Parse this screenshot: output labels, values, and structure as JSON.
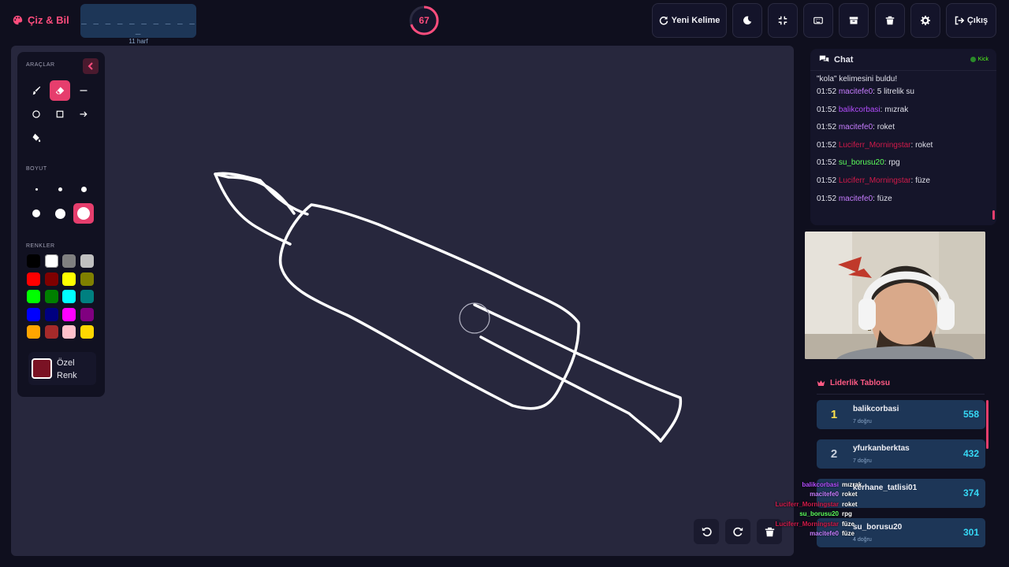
{
  "app": {
    "brand": "Çiz & Bil"
  },
  "word": {
    "dashes": "_ _ _ _ _ _ _ _ _ _ _",
    "letters": "11 harf"
  },
  "timer": {
    "value": "67",
    "fraction_remaining": 0.7
  },
  "topbar": {
    "new_word": "Yeni Kelime",
    "logout": "Çıkış"
  },
  "tools": {
    "heading": "ARAÇLAR",
    "size_heading": "BOYUT",
    "colors_heading": "RENKLER",
    "active_tool": "eraser",
    "active_size": 6,
    "custom_color_label": "Özel Renk",
    "custom_color": "#7a1224",
    "palette": [
      "#000000",
      "#ffffff",
      "#808080",
      "#c0c0c0",
      "#ff0000",
      "#800000",
      "#ffff00",
      "#808000",
      "#00ff00",
      "#008000",
      "#00ffff",
      "#008080",
      "#0000ff",
      "#000080",
      "#ff00ff",
      "#800080",
      "#ffa500",
      "#a52a2a",
      "#ffc0cb",
      "#ffd700"
    ]
  },
  "chat": {
    "title": "Chat",
    "platform": "Kick",
    "system_line1": "\"kola\" kelimesini buldu!",
    "messages": [
      {
        "time": "01:52",
        "user": "macitefe0",
        "color": "#c77dff",
        "text": "5 litrelik su"
      },
      {
        "time": "01:52",
        "user": "balikcorbasi",
        "color": "#b44dff",
        "text": "mızrak"
      },
      {
        "time": "01:52",
        "user": "macitefe0",
        "color": "#c77dff",
        "text": "roket"
      },
      {
        "time": "01:52",
        "user": "Luciferr_Morningstar",
        "color": "#d11a4a",
        "text": "roket"
      },
      {
        "time": "01:52",
        "user": "su_borusu20",
        "color": "#5cff5c",
        "text": "rpg"
      },
      {
        "time": "01:52",
        "user": "Luciferr_Morningstar",
        "color": "#d11a4a",
        "text": "füze"
      },
      {
        "time": "01:52",
        "user": "macitefe0",
        "color": "#c77dff",
        "text": "füze"
      }
    ]
  },
  "leaderboard": {
    "title": "Liderlik Tablosu",
    "rows": [
      {
        "rank": "1",
        "name": "balikcorbasi",
        "correct": "7 doğru",
        "score": "558",
        "rank_color": "#ffe14d"
      },
      {
        "rank": "2",
        "name": "yfurkanberktas",
        "correct": "7 doğru",
        "score": "432",
        "rank_color": "#c8d0dc"
      },
      {
        "rank": "",
        "name": "kerhane_tatlisi01",
        "correct": "",
        "score": "374",
        "rank_color": "#c8d0dc"
      },
      {
        "rank": "",
        "name": "su_borusu20",
        "correct": "4 doğru",
        "score": "301",
        "rank_color": "#c8d0dc"
      }
    ]
  },
  "overlay_chat": [
    {
      "user": "balikcorbasi",
      "color": "#b44dff",
      "text": "mızrak"
    },
    {
      "user": "macitefe0",
      "color": "#c77dff",
      "text": "roket"
    },
    {
      "user": "Luciferr_Morningstar",
      "color": "#d11a4a",
      "text": "roket"
    },
    {
      "user": "su_borusu20",
      "color": "#5cff5c",
      "text": "rpg"
    },
    {
      "user": "Luciferr_Morningstar",
      "color": "#d11a4a",
      "text": "füze"
    },
    {
      "user": "macitefe0",
      "color": "#c77dff",
      "text": "füze"
    }
  ]
}
